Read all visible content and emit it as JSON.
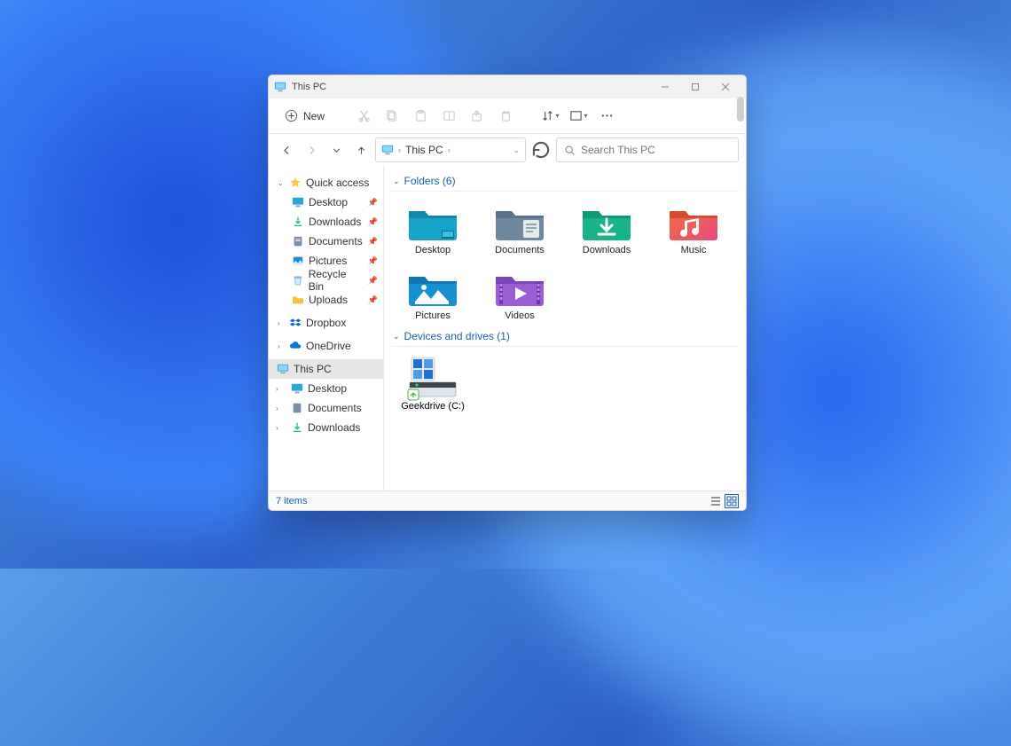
{
  "window": {
    "title": "This PC"
  },
  "toolbar": {
    "new_label": "New"
  },
  "address": {
    "location": "This PC"
  },
  "search": {
    "placeholder": "Search This PC"
  },
  "sidebar": {
    "quick_access": {
      "label": "Quick access",
      "items": [
        {
          "label": "Desktop"
        },
        {
          "label": "Downloads"
        },
        {
          "label": "Documents"
        },
        {
          "label": "Pictures"
        },
        {
          "label": "Recycle Bin"
        },
        {
          "label": "Uploads"
        }
      ]
    },
    "dropbox": {
      "label": "Dropbox"
    },
    "onedrive": {
      "label": "OneDrive"
    },
    "this_pc": {
      "label": "This PC",
      "items": [
        {
          "label": "Desktop"
        },
        {
          "label": "Documents"
        },
        {
          "label": "Downloads"
        }
      ]
    }
  },
  "sections": {
    "folders": {
      "title": "Folders (6)",
      "items": [
        {
          "label": "Desktop"
        },
        {
          "label": "Documents"
        },
        {
          "label": "Downloads"
        },
        {
          "label": "Music"
        },
        {
          "label": "Pictures"
        },
        {
          "label": "Videos"
        }
      ]
    },
    "drives": {
      "title": "Devices and drives (1)",
      "items": [
        {
          "label": "Geekdrive (C:)"
        }
      ]
    }
  },
  "status": {
    "count_text": "7 items"
  }
}
